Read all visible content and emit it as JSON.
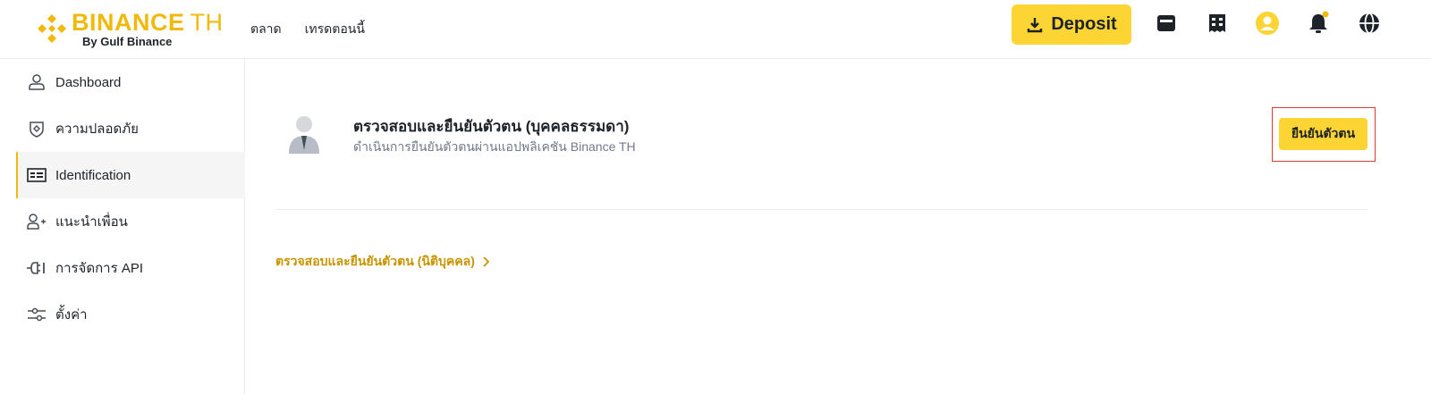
{
  "brand": {
    "name": "BINANCE",
    "region": "TH",
    "tagline": "By Gulf Binance",
    "accent": "#f0b90b",
    "button_yellow": "#fcd535"
  },
  "nav": [
    {
      "label": "ตลาด"
    },
    {
      "label": "เทรดตอนนี้"
    }
  ],
  "header": {
    "deposit_label": "Deposit",
    "icons": [
      "download-icon",
      "wallet-icon",
      "orders-icon",
      "user-avatar-icon",
      "bell-icon",
      "globe-icon"
    ]
  },
  "sidebar": {
    "items": [
      {
        "label": "Dashboard",
        "icon": "user-icon",
        "active": false
      },
      {
        "label": "ความปลอดภัย",
        "icon": "shield-icon",
        "active": false
      },
      {
        "label": "Identification",
        "icon": "id-card-icon",
        "active": true
      },
      {
        "label": "แนะนำเพื่อน",
        "icon": "add-user-icon",
        "active": false
      },
      {
        "label": "การจัดการ API",
        "icon": "api-plug-icon",
        "active": false
      },
      {
        "label": "ตั้งค่า",
        "icon": "settings-sliders-icon",
        "active": false
      }
    ]
  },
  "main": {
    "personal": {
      "title": "ตรวจสอบและยืนยันตัวตน (บุคคลธรรมดา)",
      "subtitle": "ดำเนินการยืนยันตัวตนผ่านแอปพลิเคชัน Binance TH",
      "button_label": "ยืนยันตัวตน"
    },
    "corporate_link": "ตรวจสอบและยืนยันตัวตน (นิติบุคคล)"
  }
}
